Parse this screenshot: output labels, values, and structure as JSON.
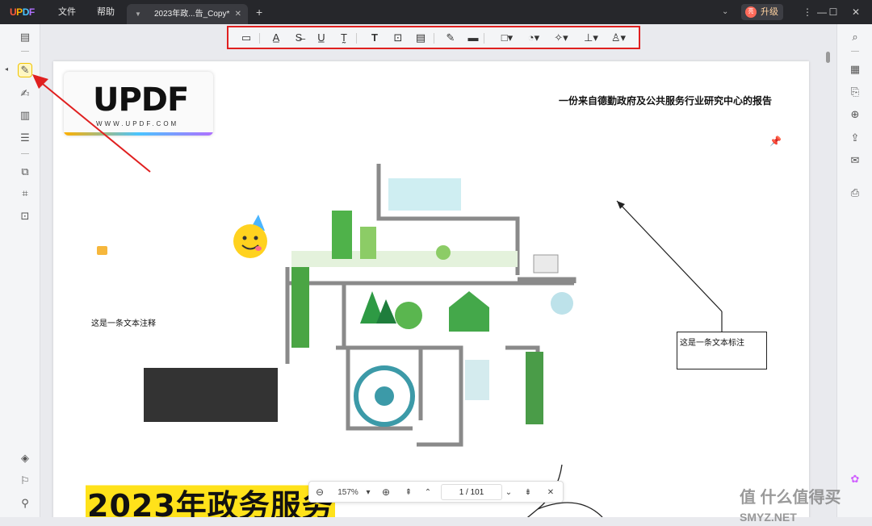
{
  "app": {
    "logo": {
      "u": "U",
      "p": "P",
      "d": "D",
      "f": "F"
    },
    "menu": [
      "文件",
      "帮助"
    ],
    "tab": {
      "title": "2023年政...告_Copy*",
      "close": "✕"
    },
    "new_tab": "+",
    "upgrade": {
      "label": "升级",
      "avatar": "亮"
    },
    "window": {
      "menu": "⋮",
      "minimize": "—",
      "maximize": "☐",
      "close": "✕"
    }
  },
  "toolbar": {
    "items": [
      {
        "name": "comment-icon",
        "glyph": "▭"
      },
      {
        "name": "highlight-icon",
        "glyph": "A̲"
      },
      {
        "name": "strikethrough-icon",
        "glyph": "S̶"
      },
      {
        "name": "underline-icon",
        "glyph": "U̲"
      },
      {
        "name": "squiggly-icon",
        "glyph": "T̰"
      },
      {
        "name": "text-icon",
        "glyph": "T"
      },
      {
        "name": "textbox-icon",
        "glyph": "⊡"
      },
      {
        "name": "text-callout-icon",
        "glyph": "▤"
      },
      {
        "name": "pencil-icon",
        "glyph": "✎"
      },
      {
        "name": "eraser-icon",
        "glyph": "▬"
      },
      {
        "name": "shape-icon",
        "glyph": "□▾"
      },
      {
        "name": "sticker-icon",
        "glyph": "◔▾"
      },
      {
        "name": "pin-icon",
        "glyph": "✧▾"
      },
      {
        "name": "stamp-icon",
        "glyph": "⊥▾"
      },
      {
        "name": "signature-icon",
        "glyph": "♙▾"
      }
    ]
  },
  "document": {
    "header_text": "一份来自德勤政府及公共服务行业研究中心的报告",
    "logo": {
      "big": "UPDF",
      "small": "WWW.UPDF.COM"
    },
    "comment_text": "这是一条文本注释",
    "callout_text": "这是一条文本标注",
    "big_title": "2023年政务服务"
  },
  "zoom": {
    "zoom_out": "⊖",
    "level": "157%",
    "dropdown": "▾",
    "zoom_in": "⊕",
    "first_page": "⇞",
    "prev_page": "⌃",
    "page_label": "1 / 101",
    "next_page": "⌄",
    "last_page": "⇟",
    "close": "✕"
  },
  "watermark": "值 什么值得买",
  "watermark_small": "SMYZ.NET",
  "colors": {
    "accent": "#e02020",
    "highlight": "#ffe21a",
    "titlebar": "#26272b"
  }
}
